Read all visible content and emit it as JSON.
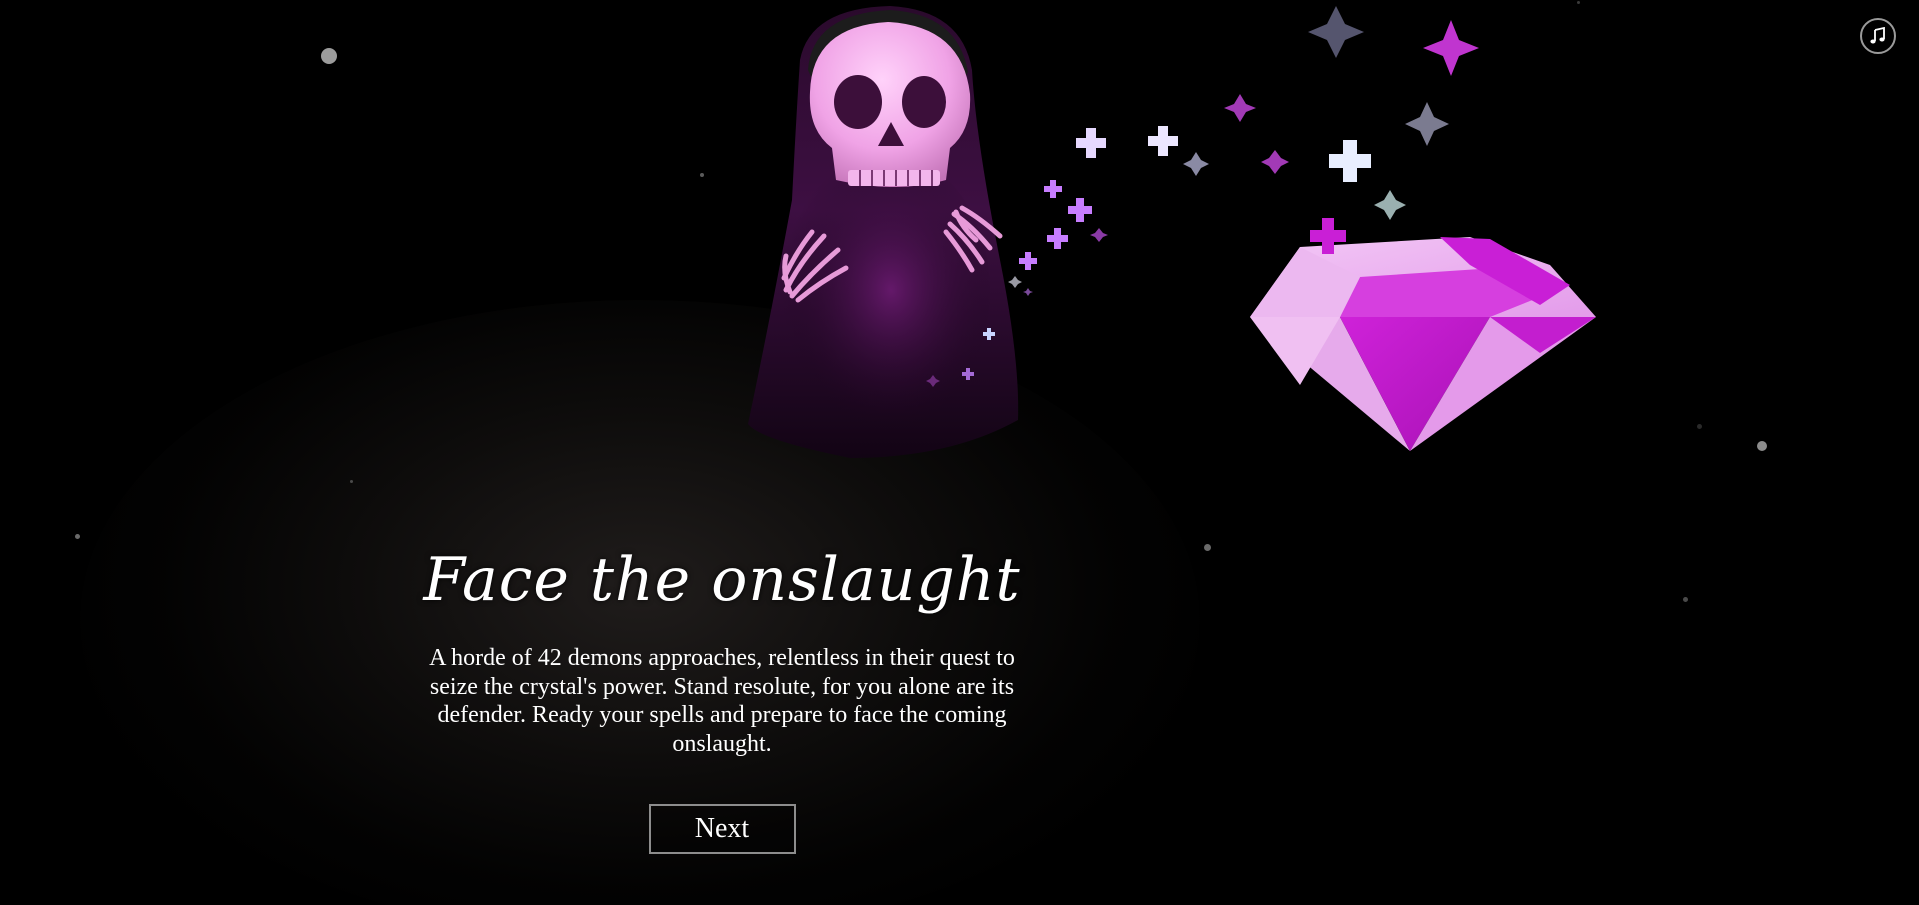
{
  "story": {
    "title": "Face the onslaught",
    "text": "A horde of 42 demons approaches, relentless in their quest to seize the crystal's power. Stand resolute, for you alone are its defender. Ready your spells and prepare to face the coming onslaught.",
    "next_label": "Next"
  },
  "controls": {
    "music_icon": "music-note-icon"
  },
  "scene": {
    "characters": [
      "reaper",
      "crystal"
    ],
    "colors": {
      "background": "#000000",
      "skull": "#f0a8e8",
      "crystal": "#e07ef0",
      "crystal_deep": "#c91fd6",
      "sparkle": "#c77dff",
      "sparkle_light": "#e8eeff",
      "text": "#ffffff",
      "button_border": "#8d8d8d"
    }
  }
}
